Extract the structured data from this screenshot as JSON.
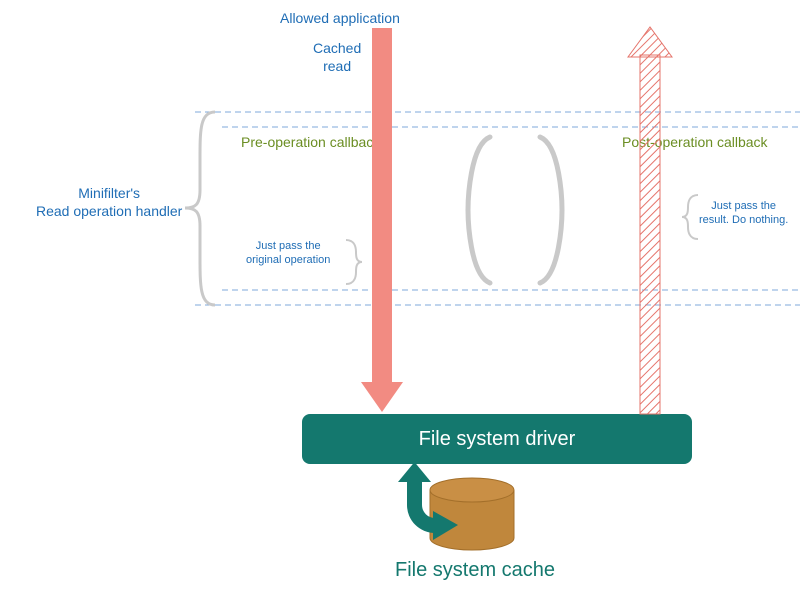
{
  "labels": {
    "allowed_app": "Allowed application",
    "cached_read_l1": "Cached",
    "cached_read_l2": "read",
    "minifilter_l1": "Minifilter's",
    "minifilter_l2": "Read operation handler",
    "pre_cb": "Pre-operation callback",
    "post_cb": "Post-operation callback",
    "pass_orig_l1": "Just pass the",
    "pass_orig_l2": "original operation",
    "pass_res_l1": "Just pass the",
    "pass_res_l2": "result. Do nothing.",
    "fs_driver": "File system driver",
    "fs_cache": "File system cache"
  },
  "colors": {
    "blue_text": "#1f6db5",
    "olive_text": "#6b8e23",
    "teal": "#14786e",
    "teal_dark": "#0f6a60",
    "pink": "#f28b82",
    "pink_stroke": "#e5746b",
    "dash": "#8fb4e0",
    "brace": "#c9c9c9",
    "brown": "#c0873c",
    "brown_dark": "#a36f2a"
  }
}
